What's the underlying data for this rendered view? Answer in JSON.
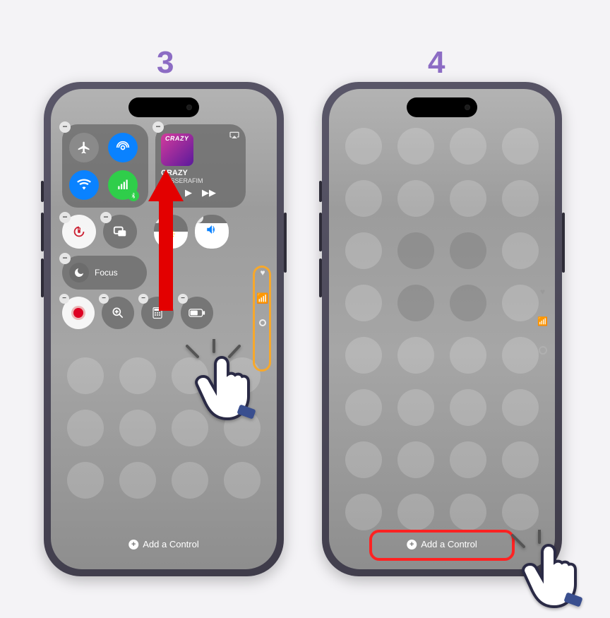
{
  "steps": {
    "left": "3",
    "right": "4"
  },
  "colors": {
    "accent_purple": "#8c6cc4",
    "arrow_red": "#e30000",
    "ring_orange": "#f7a82b",
    "highlight_red": "#f22"
  },
  "connectivity": {
    "airplane": {
      "state": "off"
    },
    "airdrop": {
      "state": "on"
    },
    "wifi": {
      "state": "on"
    },
    "bluetooth": {
      "state": "on"
    }
  },
  "now_playing": {
    "album_word": "CRAZY",
    "title": "CRAZY",
    "artist": "LE SSERAFIM"
  },
  "focus": {
    "label": "Focus"
  },
  "sliders": {
    "brightness_pct": 50,
    "volume_pct": 75
  },
  "bottom_row_icons": [
    "record",
    "magnifier",
    "calculator",
    "battery"
  ],
  "add_control": {
    "label": "Add a Control"
  }
}
